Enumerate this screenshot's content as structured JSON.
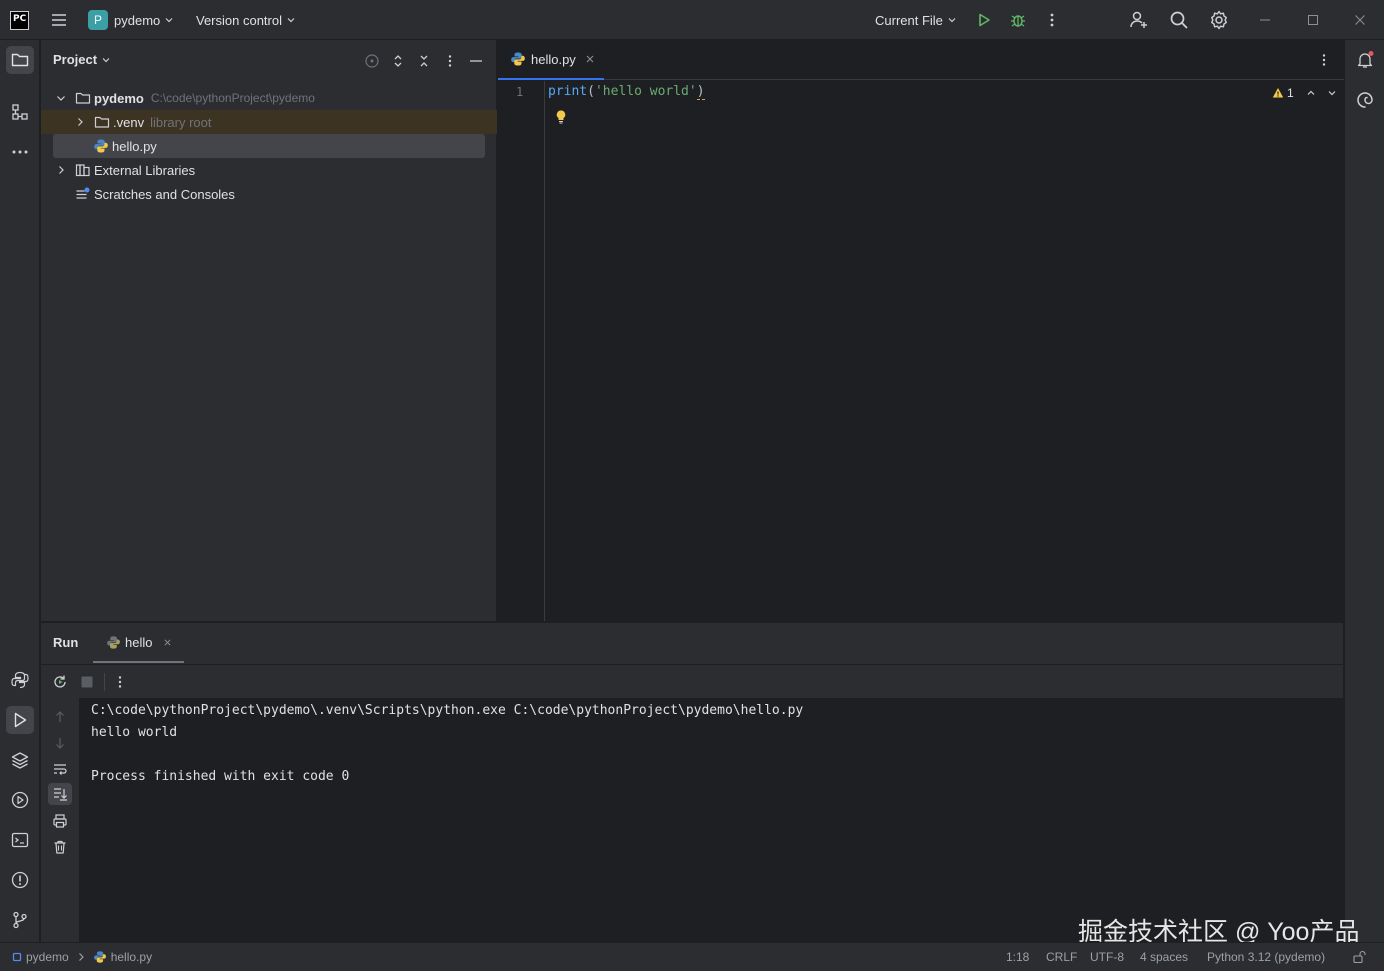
{
  "titlebar": {
    "app_logo": "PC",
    "project_badge": "P",
    "project_name": "pydemo",
    "vcs_label": "Version control",
    "run_config": "Current File"
  },
  "project_panel": {
    "title": "Project",
    "tree": [
      {
        "label": "pydemo",
        "hint": "C:\\code\\pythonProject\\pydemo",
        "icon": "folder-icon",
        "expanded": true
      },
      {
        "label": ".venv",
        "hint": "library root",
        "icon": "folder-icon",
        "expanded": false
      },
      {
        "label": "hello.py",
        "hint": "",
        "icon": "python-file-icon",
        "selected": true
      },
      {
        "label": "External Libraries",
        "hint": "",
        "icon": "library-icon",
        "expanded": false
      },
      {
        "label": "Scratches and Consoles",
        "hint": "",
        "icon": "scratches-icon"
      }
    ]
  },
  "editor": {
    "tab_label": "hello.py",
    "line_number": "1",
    "code": {
      "func": "print",
      "open": "(",
      "string": "'hello world'",
      "close": ")"
    },
    "warning_count": "1"
  },
  "run_panel": {
    "title": "Run",
    "tab_label": "hello",
    "console": [
      "C:\\code\\pythonProject\\pydemo\\.venv\\Scripts\\python.exe C:\\code\\pythonProject\\pydemo\\hello.py",
      "hello world",
      "",
      "Process finished with exit code 0"
    ]
  },
  "statusbar": {
    "breadcrumb_project": "pydemo",
    "breadcrumb_file": "hello.py",
    "position": "1:18",
    "line_ending": "CRLF",
    "encoding": "UTF-8",
    "indent": "4 spaces",
    "interpreter": "Python 3.12 (pydemo)"
  },
  "watermark": "掘金技术社区 @ Yoo产品",
  "colors": {
    "accent_green": "#5fb865",
    "accent_blue": "#3574f0",
    "string": "#6aab73",
    "keyword_func": "#56a8f5",
    "background": "#1e1f22",
    "panel": "#2b2d30"
  }
}
